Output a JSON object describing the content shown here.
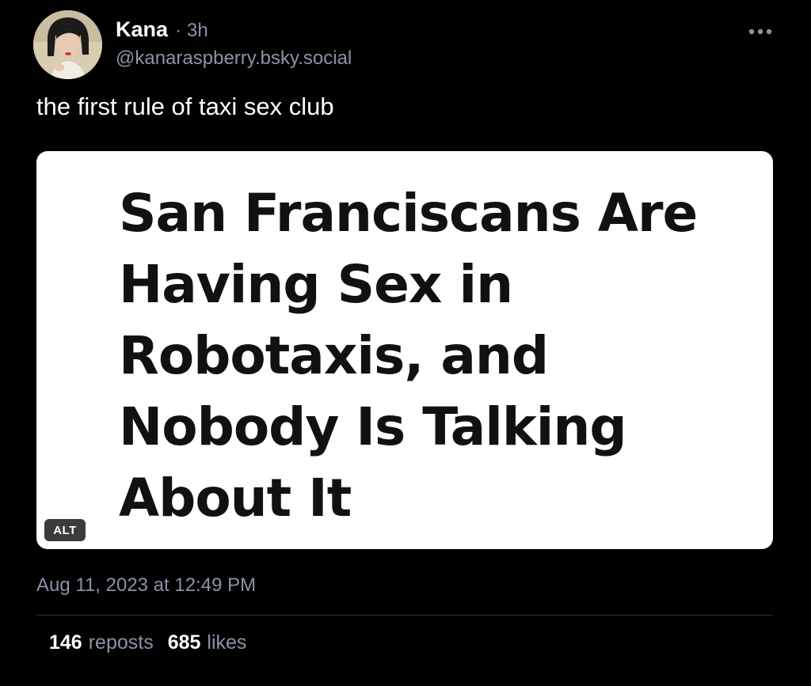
{
  "post": {
    "author": {
      "display_name": "Kana",
      "separator": "·",
      "time_ago": "3h",
      "handle": "@kanaraspberry.bsky.social"
    },
    "text": "the first rule of taxi sex club",
    "embed": {
      "headline_lines": [
        "San Franciscans Are",
        "Having Sex in",
        "Robotaxis, and",
        "Nobody Is Talking",
        "About It"
      ],
      "alt_badge": "ALT"
    },
    "timestamp": "Aug 11, 2023 at 12:49 PM",
    "stats": {
      "reposts_count": "146",
      "reposts_label": "reposts",
      "likes_count": "685",
      "likes_label": "likes"
    }
  },
  "icons": {
    "more": "more-horizontal-icon"
  },
  "colors": {
    "background": "#000000",
    "text_primary": "#ffffff",
    "text_secondary": "#8a93a6",
    "divider": "#2a2d33",
    "embed_background": "#ffffff",
    "alt_badge_background": "#3c3c3c"
  }
}
